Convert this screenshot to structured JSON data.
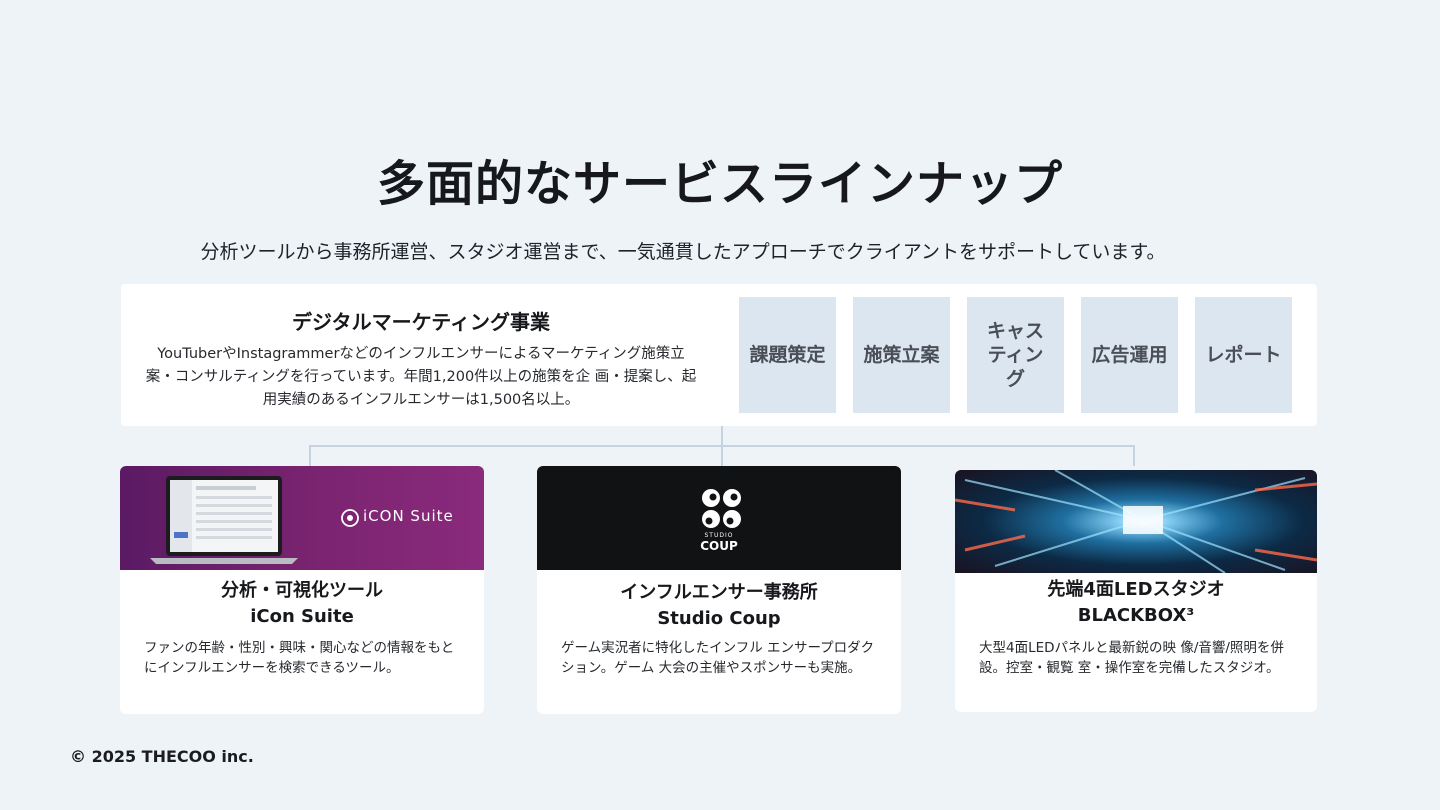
{
  "header": {
    "title": "多面的なサービスラインナップ",
    "subtitle": "分析ツールから事務所運営、スタジオ運営まで、一気通貫したアプローチでクライアントをサポートしています。"
  },
  "marketing": {
    "heading": "デジタルマーケティング事業",
    "description": "YouTuberやInstagrammerなどのインフルエンサーによるマーケティング施策立案・コンサルティングを行っています。年間1,200件以上の施策を企 画・提案し、起用実績のあるインフルエンサーは1,500名以上。",
    "steps": [
      "課題策定",
      "施策立案",
      "キャスティング",
      "広告運用",
      "レポート"
    ]
  },
  "services": [
    {
      "title_line1": "分析・可視化ツール",
      "title_line2": "iCon Suite",
      "logo_text": "iCON Suite",
      "description": "ファンの年齢・性別・興味・関心などの情報をもとにインフルエンサーを検索できるツール。"
    },
    {
      "title_line1": "インフルエンサー事務所",
      "title_line2": "Studio Coup",
      "logo_text_top": "STUDIO",
      "logo_text_bottom": "COUP",
      "description": "ゲーム実況者に特化したインフル エンサープロダクション。ゲーム 大会の主催やスポンサーも実施。"
    },
    {
      "title_line1": "先端4面LEDスタジオ",
      "title_line2": "BLACKBOX³",
      "description": "大型4面LEDパネルと最新鋭の映 像/音響/照明を併設。控室・観覧 室・操作室を完備したスタジオ。"
    }
  ],
  "footer": {
    "copyright": "© 2025 THECOO inc."
  },
  "colors": {
    "background": "#eef3f8",
    "step_fill": "#dce6f0",
    "icon_suite_gradient": [
      "#5b1a64",
      "#8a2a7c"
    ],
    "studio_coup_bg": "#111214"
  }
}
